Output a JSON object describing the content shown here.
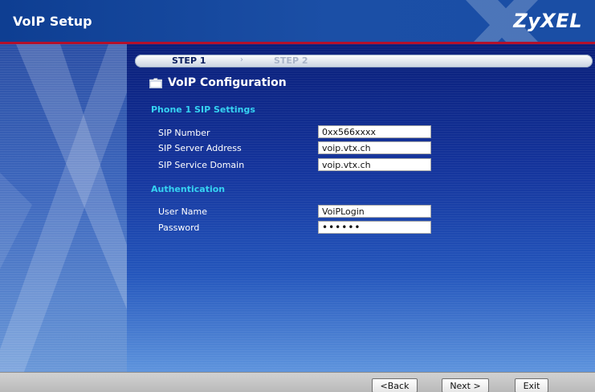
{
  "window": {
    "title": "VoIP Setup",
    "brand": "ZyXEL"
  },
  "wizard": {
    "steps": [
      "STEP 1",
      "STEP 2"
    ],
    "step_arrow": "›",
    "active_step": 1,
    "heading": "VoIP Configuration"
  },
  "sip_section": {
    "title": "Phone 1 SIP Settings",
    "fields": [
      {
        "label": "SIP Number",
        "value": "0xx566xxxx"
      },
      {
        "label": "SIP Server Address",
        "value": "voip.vtx.ch"
      },
      {
        "label": "SIP Service Domain",
        "value": "voip.vtx.ch"
      }
    ]
  },
  "auth_section": {
    "title": "Authentication",
    "fields": [
      {
        "label": "User Name",
        "value": "VoiPLogin"
      },
      {
        "label": "Password",
        "value": "••••••"
      }
    ]
  },
  "footer": {
    "back_label": "<Back",
    "next_label": "Next >",
    "exit_label": "Exit"
  },
  "icons": {
    "heading_icon": "folder-icon"
  },
  "colors": {
    "title_bar": "#1b4fa6",
    "accent_line": "#b3102b",
    "section_title": "#35d3f2",
    "main_bg_top": "#0a1f7a",
    "main_bg_bottom": "#5e94dd"
  }
}
